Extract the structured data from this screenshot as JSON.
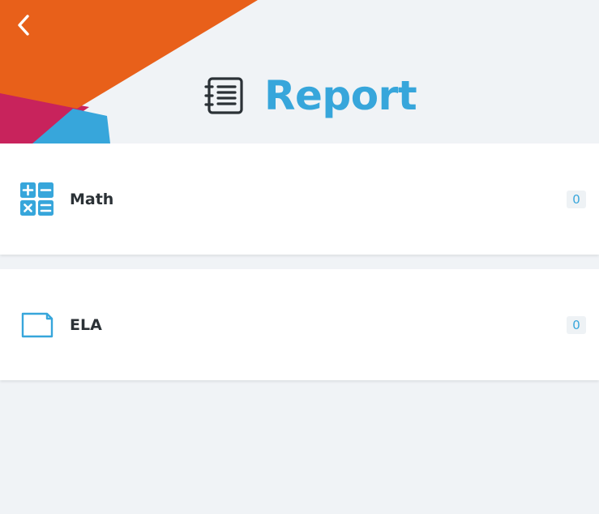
{
  "header": {
    "title": "Report",
    "back_icon": "chevron-left-icon",
    "title_icon": "notebook-list-icon",
    "decor_colors": {
      "orange": "#e8601a",
      "magenta": "#c8235c",
      "blue": "#37a6db"
    }
  },
  "subjects": [
    {
      "label": "Math",
      "icon": "calculator-icon",
      "count": "0"
    },
    {
      "label": "ELA",
      "icon": "notecard-icon",
      "count": "0"
    }
  ],
  "colors": {
    "accent": "#37a6db",
    "background": "#f0f3f6",
    "text": "#2b3136"
  }
}
